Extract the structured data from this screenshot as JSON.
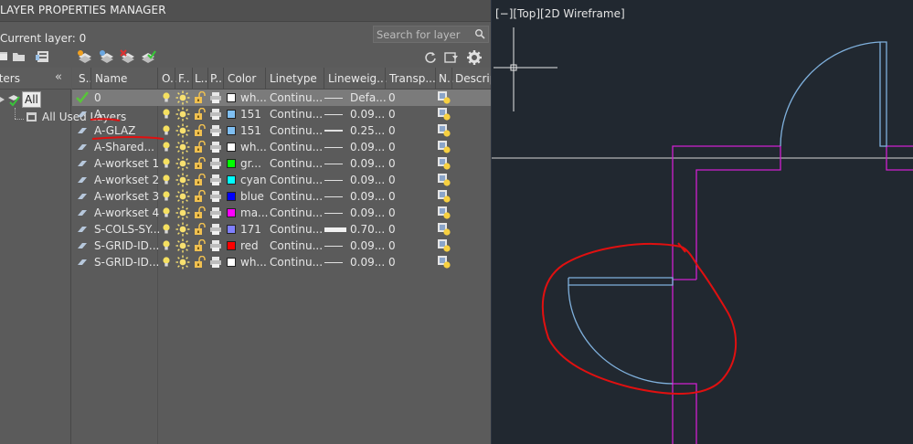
{
  "panel": {
    "title": "LAYER PROPERTIES MANAGER",
    "current_layer": "Current layer: 0",
    "search_placeholder": "Search for layer"
  },
  "filters": {
    "header": "Filters",
    "items": [
      "All",
      "All Used Layers"
    ]
  },
  "columns": [
    "S..",
    "Name",
    "O..",
    "F..",
    "L..",
    "P..",
    "Color",
    "Linetype",
    "Lineweig...",
    "Transp...",
    "N..",
    "Descrip"
  ],
  "layers": [
    {
      "name": "0",
      "color_name": "wh...",
      "color": "#ffffff",
      "linetype": "Continu...",
      "lineweight": "Defa...",
      "transparency": "0",
      "current": true
    },
    {
      "name": "A-",
      "color_name": "151",
      "color": "#7fbff2",
      "linetype": "Continu...",
      "lineweight": "0.09...",
      "transparency": "0",
      "current": false
    },
    {
      "name": "A-GLAZ",
      "color_name": "151",
      "color": "#7fbff2",
      "linetype": "Continu...",
      "lineweight": "0.25...",
      "transparency": "0",
      "current": false
    },
    {
      "name": "A-Shared...",
      "color_name": "wh...",
      "color": "#ffffff",
      "linetype": "Continu...",
      "lineweight": "0.09...",
      "transparency": "0",
      "current": false
    },
    {
      "name": "A-workset 1",
      "color_name": "gr...",
      "color": "#00ff00",
      "linetype": "Continu...",
      "lineweight": "0.09...",
      "transparency": "0",
      "current": false
    },
    {
      "name": "A-workset 2",
      "color_name": "cyan",
      "color": "#00ffff",
      "linetype": "Continu...",
      "lineweight": "0.09...",
      "transparency": "0",
      "current": false
    },
    {
      "name": "A-workset 3",
      "color_name": "blue",
      "color": "#0000ff",
      "linetype": "Continu...",
      "lineweight": "0.09...",
      "transparency": "0",
      "current": false
    },
    {
      "name": "A-workset 4",
      "color_name": "ma...",
      "color": "#ff00ff",
      "linetype": "Continu...",
      "lineweight": "0.09...",
      "transparency": "0",
      "current": false
    },
    {
      "name": "S-COLS-SY...",
      "color_name": "171",
      "color": "#7f7fff",
      "linetype": "Continu...",
      "lineweight": "0.70...",
      "transparency": "0",
      "current": false
    },
    {
      "name": "S-GRID-ID...",
      "color_name": "red",
      "color": "#ff0000",
      "linetype": "Continu...",
      "lineweight": "0.09...",
      "transparency": "0",
      "current": false
    },
    {
      "name": "S-GRID-ID...",
      "color_name": "wh...",
      "color": "#ffffff",
      "linetype": "Continu...",
      "lineweight": "0.09...",
      "transparency": "0",
      "current": false
    }
  ],
  "viewport": {
    "label": "[−][Top][2D Wireframe]"
  },
  "colors": {
    "panel_bg": "#5b5b5b",
    "canvas_bg": "#212830",
    "door_blue": "#7fb0dc",
    "wall_magenta": "#d020d0",
    "annotation_red": "#e01010"
  }
}
